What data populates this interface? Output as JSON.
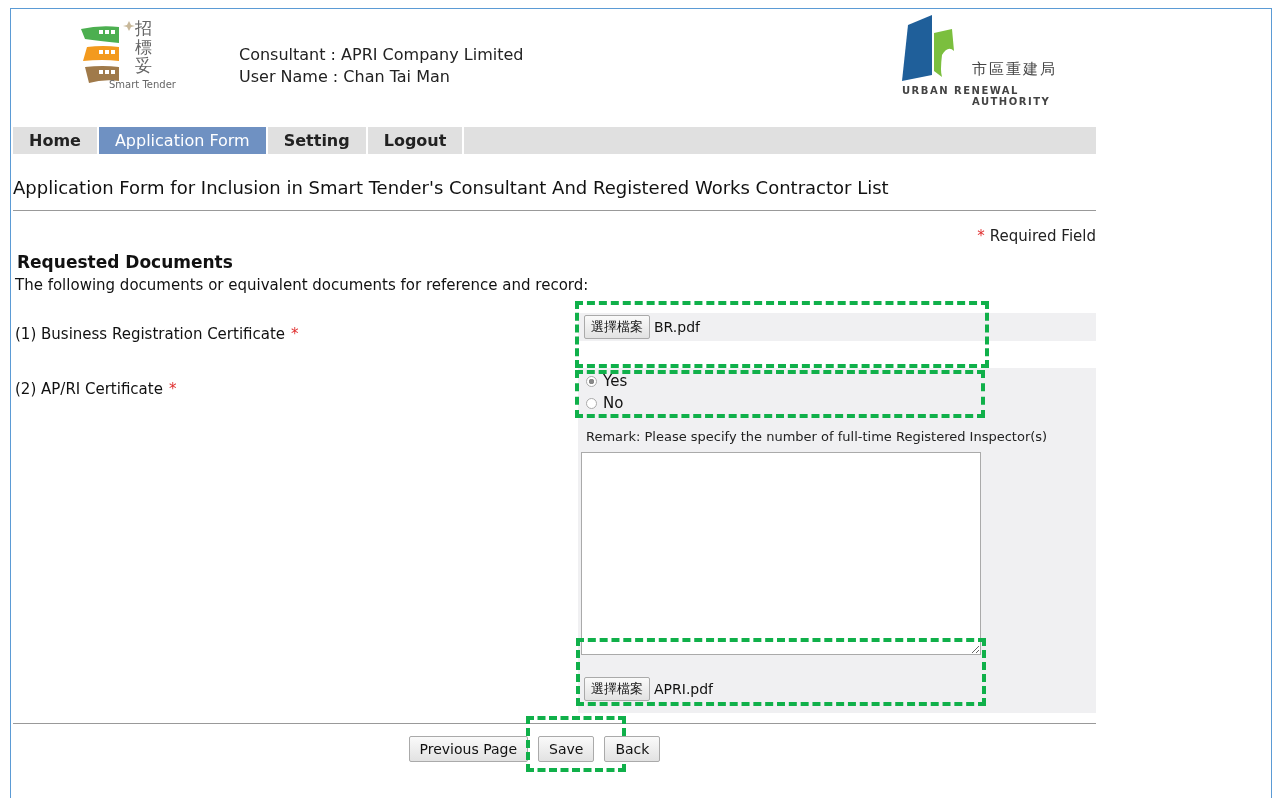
{
  "header": {
    "logo_left": {
      "chinese": "招標妥",
      "english": "Smart Tender"
    },
    "consultant": "Consultant : APRI Company Limited",
    "user_name": "User Name : Chan Tai Man",
    "logo_right": {
      "chinese": "市區重建局",
      "english_line_1": "URBAN RENEWAL",
      "english_line_2": "AUTHORITY"
    }
  },
  "nav": [
    {
      "label": "Home",
      "selected": false
    },
    {
      "label": "Application Form",
      "selected": true
    },
    {
      "label": "Setting",
      "selected": false
    },
    {
      "label": "Logout",
      "selected": false
    }
  ],
  "page_title": "Application Form for Inclusion in Smart Tender's Consultant And Registered Works Contractor List",
  "required_note": {
    "mark": "*",
    "text": "Required Field"
  },
  "section": {
    "heading": "Requested Documents",
    "description": "The following documents or equivalent documents for reference and record:"
  },
  "documents": [
    {
      "kind": "file",
      "label": "(1) Business Registration Certificate",
      "required_mark": "*",
      "file": {
        "button": "選擇檔案",
        "filename": "BR.pdf",
        "highlighted": true
      }
    },
    {
      "kind": "radio-file",
      "label": "(2) AP/RI Certificate",
      "required_mark": "*",
      "radios": [
        {
          "label": "Yes",
          "selected": true
        },
        {
          "label": "No",
          "selected": false
        }
      ],
      "radios_highlighted": true,
      "remark": "Remark: Please specify the number of full-time Registered Inspector(s)",
      "file": {
        "button": "選擇檔案",
        "filename": "APRI.pdf",
        "highlighted": true
      }
    }
  ],
  "buttons": [
    {
      "label": "Previous Page",
      "highlighted": false
    },
    {
      "label": "Save",
      "highlighted": true
    },
    {
      "label": "Back",
      "highlighted": false
    }
  ]
}
